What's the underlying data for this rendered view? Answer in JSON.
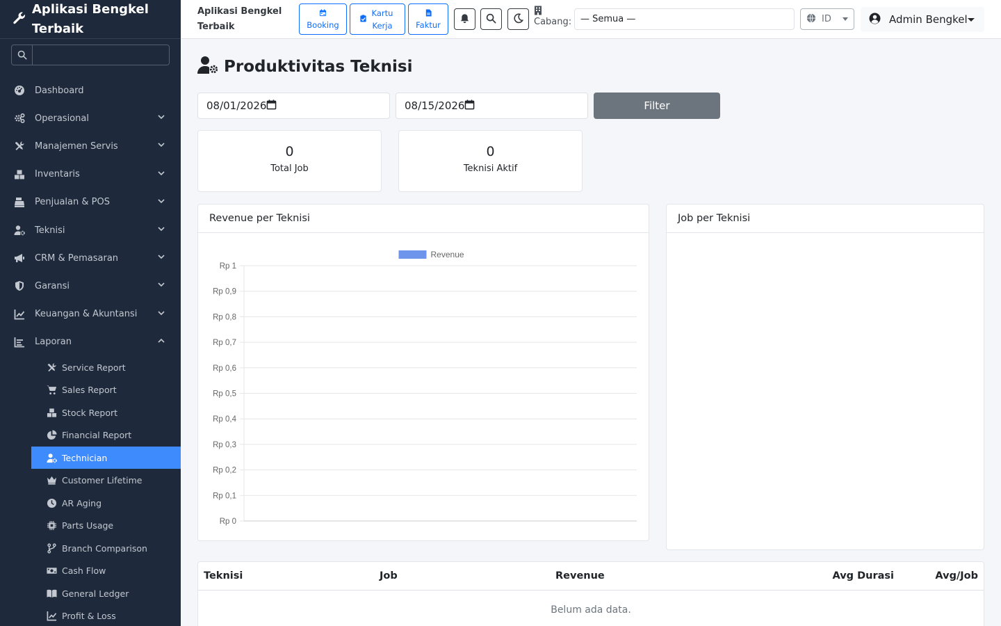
{
  "brand": {
    "title": "Aplikasi Bengkel Terbaik"
  },
  "sidebar": {
    "search_placeholder": "",
    "items": [
      {
        "label": "Dashboard",
        "icon": "dashboard-icon",
        "expandable": false
      },
      {
        "label": "Operasional",
        "icon": "cogs-icon",
        "expandable": true
      },
      {
        "label": "Manajemen Servis",
        "icon": "tools-icon",
        "expandable": true
      },
      {
        "label": "Inventaris",
        "icon": "boxes-icon",
        "expandable": true
      },
      {
        "label": "Penjualan & POS",
        "icon": "cash-register-icon",
        "expandable": true
      },
      {
        "label": "Teknisi",
        "icon": "user-cog-icon",
        "expandable": true
      },
      {
        "label": "CRM & Pemasaran",
        "icon": "megaphone-icon",
        "expandable": true
      },
      {
        "label": "Garansi",
        "icon": "shield-icon",
        "expandable": true
      },
      {
        "label": "Keuangan & Akuntansi",
        "icon": "chart-line-icon",
        "expandable": true
      },
      {
        "label": "Laporan",
        "icon": "report-chart-icon",
        "expandable": true,
        "expanded": true
      }
    ],
    "report_items": [
      {
        "label": "Service Report",
        "icon": "tools-icon"
      },
      {
        "label": "Sales Report",
        "icon": "cart-icon"
      },
      {
        "label": "Stock Report",
        "icon": "boxes-icon"
      },
      {
        "label": "Financial Report",
        "icon": "pie-chart-icon"
      },
      {
        "label": "Technician",
        "icon": "user-cog-icon",
        "active": true
      },
      {
        "label": "Customer Lifetime",
        "icon": "crown-icon"
      },
      {
        "label": "AR Aging",
        "icon": "clock-icon"
      },
      {
        "label": "Parts Usage",
        "icon": "chip-icon"
      },
      {
        "label": "Branch Comparison",
        "icon": "branch-icon"
      },
      {
        "label": "Cash Flow",
        "icon": "money-icon"
      },
      {
        "label": "General Ledger",
        "icon": "book-icon"
      },
      {
        "label": "Profit & Loss",
        "icon": "chart-line-icon"
      }
    ]
  },
  "topbar": {
    "app_title": "Aplikasi Bengkel Terbaik",
    "quick": [
      {
        "label": "Booking",
        "icon": "calendar-icon"
      },
      {
        "label": "Kartu Kerja",
        "icon": "clipboard-check-icon"
      },
      {
        "label": "Faktur",
        "icon": "file-icon"
      }
    ],
    "cabang_label": "Cabang:",
    "branch_value": "— Semua —",
    "lang_value": "ID",
    "user_name": "Admin Bengkel"
  },
  "page": {
    "title": "Produktivitas Teknisi",
    "date_from": "08/01/2026",
    "date_to": "08/15/2026",
    "filter_label": "Filter"
  },
  "stats": [
    {
      "value": "0",
      "label": "Total Job"
    },
    {
      "value": "0",
      "label": "Teknisi Aktif"
    }
  ],
  "charts": {
    "revenue_title": "Revenue per Teknisi",
    "job_title": "Job per Teknisi"
  },
  "chart_data": {
    "type": "bar",
    "title": "",
    "categories": [],
    "series": [
      {
        "name": "Revenue",
        "values": []
      }
    ],
    "ylim": [
      0,
      1
    ],
    "yticks": [
      "Rp 0",
      "Rp 0,1",
      "Rp 0,2",
      "Rp 0,3",
      "Rp 0,4",
      "Rp 0,5",
      "Rp 0,6",
      "Rp 0,7",
      "Rp 0,8",
      "Rp 0,9",
      "Rp 1"
    ],
    "series_color": "#6d95ec",
    "grid": true,
    "legend": "top-center"
  },
  "table": {
    "headers": [
      "Teknisi",
      "Job",
      "Revenue",
      "Avg Durasi",
      "Avg/Job"
    ],
    "empty_text": "Belum ada data."
  }
}
